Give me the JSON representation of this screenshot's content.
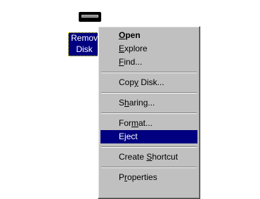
{
  "desktop_icon": {
    "label_line1": "Remov",
    "label_line2": "Disk",
    "icon": "removable-disk-icon"
  },
  "context_menu": {
    "items": [
      {
        "label": "Open",
        "hotkey_index": 0,
        "bold": true
      },
      {
        "label": "Explore",
        "hotkey_index": 0
      },
      {
        "label": "Find...",
        "hotkey_index": 0
      },
      {
        "separator": true
      },
      {
        "label": "Copy Disk...",
        "hotkey_index": 3
      },
      {
        "separator": true
      },
      {
        "label": "Sharing...",
        "hotkey_index": 1
      },
      {
        "separator": true
      },
      {
        "label": "Format...",
        "hotkey_index": 3
      },
      {
        "label": "Eject",
        "hotkey_index": 1,
        "selected": true
      },
      {
        "separator": true
      },
      {
        "label": "Create Shortcut",
        "hotkey_index": 7
      },
      {
        "separator": true
      },
      {
        "label": "Properties",
        "hotkey_index": 1
      }
    ]
  },
  "colors": {
    "selection": "#000080",
    "menu_bg": "#c0c0c0",
    "desktop_bg": "#ffffff"
  }
}
